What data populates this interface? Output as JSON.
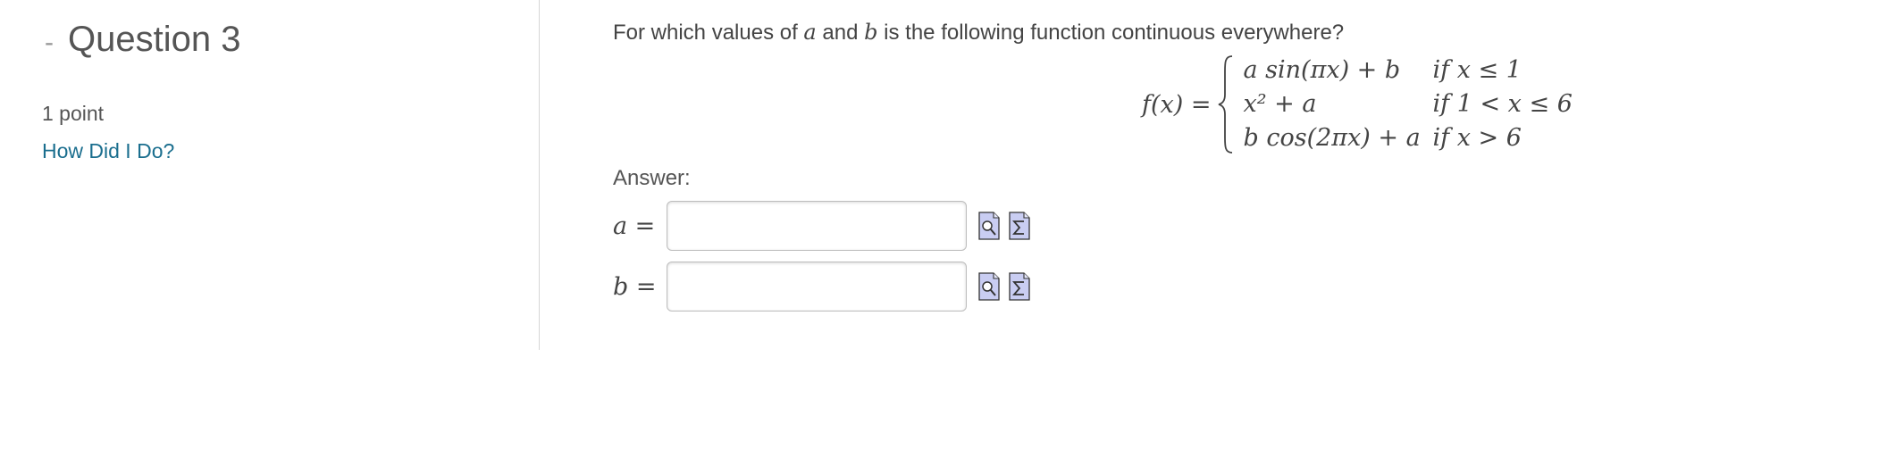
{
  "sidebar": {
    "collapse_symbol": "-",
    "question_title": "Question 3",
    "points": "1 point",
    "how_link": "How Did I Do?"
  },
  "question": {
    "prompt_pre": "For which values of ",
    "var_a": "a",
    "prompt_and": " and ",
    "var_b": "b",
    "prompt_post": " is the following function continuous everywhere?",
    "function_lhs": "f(x) =",
    "cases": [
      {
        "expr_html": "a sin(πx) + b",
        "cond": "if x ≤ 1"
      },
      {
        "expr_html": "x² + a",
        "cond": "if 1 < x ≤ 6"
      },
      {
        "expr_html": "b cos(2πx) + a",
        "cond": "if x > 6"
      }
    ]
  },
  "answer": {
    "label": "Answer:",
    "fields": [
      {
        "var_label": "a =",
        "value": "",
        "placeholder": ""
      },
      {
        "var_label": "b =",
        "value": "",
        "placeholder": ""
      }
    ]
  },
  "icons": {
    "preview": "preview-icon",
    "equation_editor": "equation-editor-icon"
  }
}
